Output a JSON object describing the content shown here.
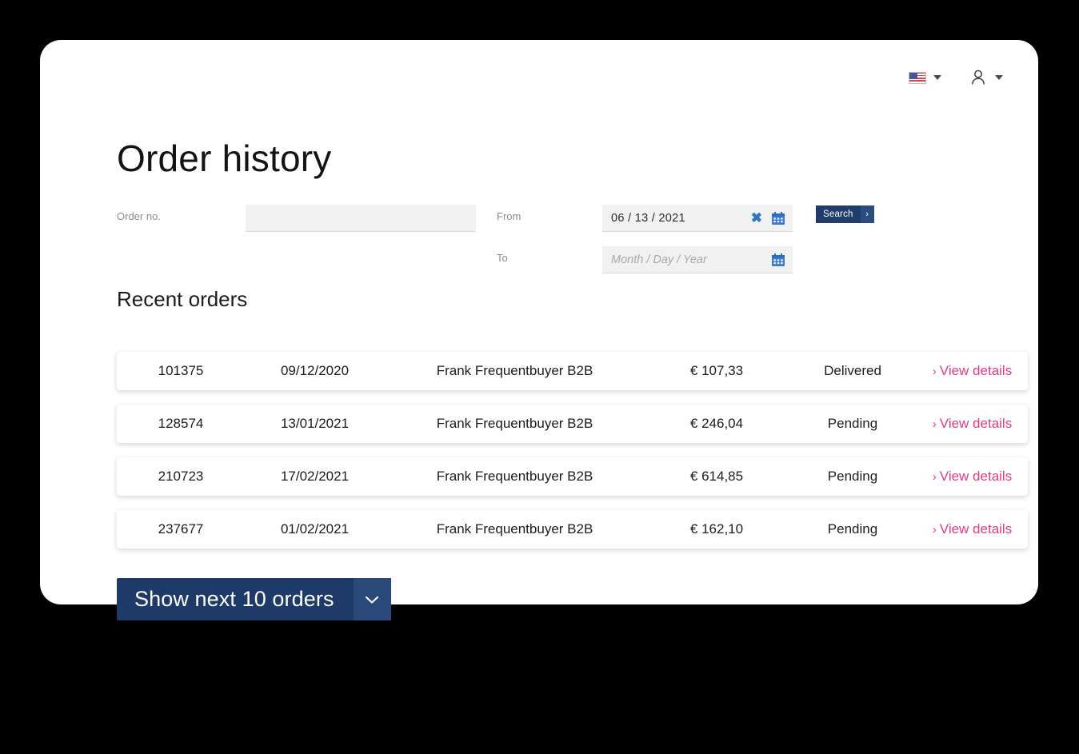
{
  "header": {
    "language_flag_icon": "us-flag-icon",
    "language_caret_icon": "chevron-down-icon",
    "account_icon": "user-icon",
    "account_caret_icon": "chevron-down-icon"
  },
  "page_title": "Order history",
  "search_form": {
    "order_no_label": "Order no.",
    "order_no_value": "",
    "order_no_placeholder": "",
    "from_label": "From",
    "from_value": "06 / 13 / 2021",
    "from_clear_icon": "close-icon",
    "from_calendar_icon": "calendar-icon",
    "to_label": "To",
    "to_placeholder": "Month / Day / Year",
    "to_value": "",
    "to_calendar_icon": "calendar-icon",
    "search_button_label": "Search",
    "search_button_chevron": "›"
  },
  "section_title": "Recent orders",
  "orders": [
    {
      "order_no": "101375",
      "date": "09/12/2020",
      "customer": "Frank Frequentbuyer B2B",
      "amount": "€ 107,33",
      "status": "Delivered",
      "link_label": "View details",
      "link_chevron": "›"
    },
    {
      "order_no": "128574",
      "date": "13/01/2021",
      "customer": "Frank Frequentbuyer B2B",
      "amount": "€ 246,04",
      "status": "Pending",
      "link_label": "View details",
      "link_chevron": "›"
    },
    {
      "order_no": "210723",
      "date": "17/02/2021",
      "customer": "Frank Frequentbuyer B2B",
      "amount": "€ 614,85",
      "status": "Pending",
      "link_label": "View details",
      "link_chevron": "›"
    },
    {
      "order_no": "237677",
      "date": "01/02/2021",
      "customer": "Frank Frequentbuyer B2B",
      "amount": "€ 162,10",
      "status": "Pending",
      "link_label": "View details",
      "link_chevron": "›"
    }
  ],
  "show_more": {
    "label": "Show next 10 orders",
    "chevron_icon": "chevron-down-icon"
  },
  "colors": {
    "accent_link": "#e23a86",
    "primary_button": "#1d3a68",
    "primary_button_light": "#29497b",
    "icon_blue": "#2e73c4",
    "page_background": "#000000",
    "card_background": "#ffffff",
    "input_background": "#f1f1f1"
  }
}
